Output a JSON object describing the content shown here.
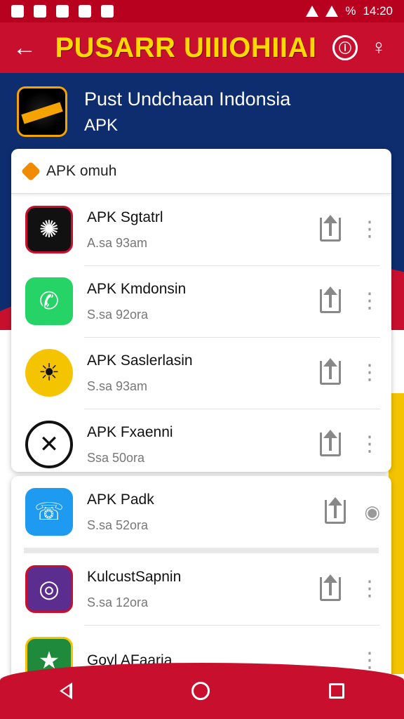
{
  "status_bar": {
    "time": "14:20",
    "battery": "%"
  },
  "app_bar": {
    "title": "PUSARR UIIIOHIIAI"
  },
  "header": {
    "title": "Pust Undchaan Indonsia",
    "subtitle": "APK"
  },
  "card1": {
    "header_label": "APK omuh",
    "items": [
      {
        "title": "APK Sgtatrl",
        "subtitle": "A.sa 93am",
        "icon_color": "#111111",
        "icon": "emblem"
      },
      {
        "title": "APK Kmdonsin",
        "subtitle": "S.sa 92ora",
        "icon_color": "#25d366",
        "icon": "phone"
      },
      {
        "title": "APK Saslerlasin",
        "subtitle": "S.sa 93am",
        "icon_color": "#f5c400",
        "icon": "sun-emblem"
      },
      {
        "title": "APK Fxaenni",
        "subtitle": "Ssa 50ora",
        "icon_color": "#ffffff",
        "icon": "x-circle"
      }
    ]
  },
  "card2": {
    "items": [
      {
        "title": "APK Padk",
        "subtitle": "S.sa 52ora",
        "icon_color": "#1e9bf0",
        "icon": "chat-bubble",
        "action": "eye"
      },
      {
        "title": "KulcustSapnin",
        "subtitle": "S.sa 12ora",
        "icon_color": "#5b2d8e",
        "icon": "game",
        "action": "more"
      },
      {
        "title": "Goyl AFaaria",
        "subtitle": "",
        "icon_color": "#1f8a3b",
        "icon": "badge",
        "action": "more"
      }
    ]
  },
  "icons": {
    "back": "←",
    "more": "⋮",
    "eye": "◉",
    "phone": "✆",
    "info": "ⓘ",
    "help": "♀"
  }
}
